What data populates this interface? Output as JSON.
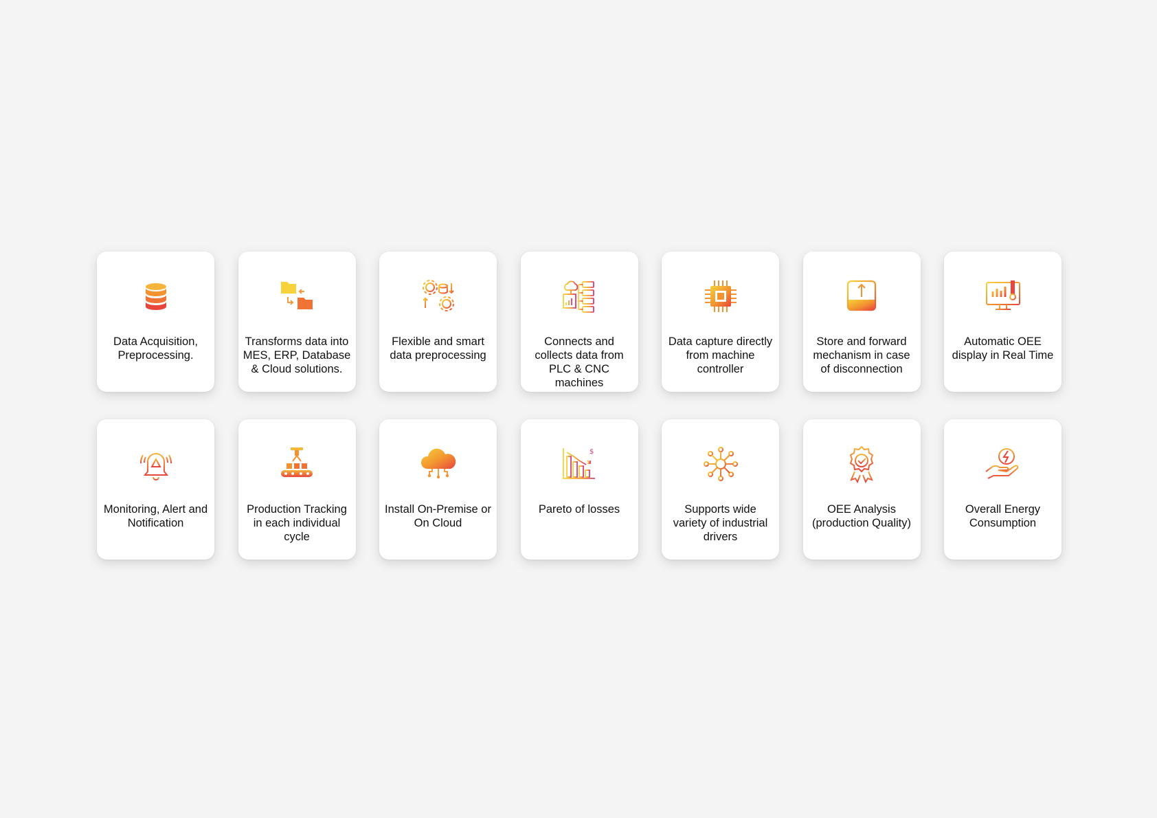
{
  "accent": {
    "gradient_start": "#f7d23a",
    "gradient_mid": "#f29330",
    "gradient_end": "#e8453c",
    "pink": "#d9367a"
  },
  "features": [
    {
      "label": "Data Acquisition,\nPreprocessing.",
      "icon": "database-icon"
    },
    {
      "label": "Transforms data into\nMES, ERP, Database\n& Cloud solutions.",
      "icon": "folder-transfer-icon"
    },
    {
      "label": "Flexible and smart\ndata preprocessing",
      "icon": "gear-data-processing-icon"
    },
    {
      "label": "Connects and\ncollects data from\nPLC & CNC\nmachines",
      "icon": "cloud-network-icon"
    },
    {
      "label": "Data capture directly\nfrom machine\ncontroller",
      "icon": "cpu-chip-icon"
    },
    {
      "label": "Store and forward\nmechanism in case\nof disconnection",
      "icon": "upload-tray-icon"
    },
    {
      "label": "Automatic OEE\ndisplay in Real Time",
      "icon": "monitor-chart-icon"
    },
    {
      "label": "Monitoring, Alert and\nNotification",
      "icon": "alert-bell-icon"
    },
    {
      "label": "Production Tracking\nin each individual\ncycle",
      "icon": "conveyor-icon"
    },
    {
      "label": "Install On-Premise or\nOn Cloud",
      "icon": "cloud-icon"
    },
    {
      "label": "Pareto of losses",
      "icon": "pareto-chart-icon"
    },
    {
      "label": "Supports wide\nvariety of industrial\ndrivers",
      "icon": "network-hub-icon"
    },
    {
      "label": "OEE Analysis\n(production Quality)",
      "icon": "quality-badge-icon"
    },
    {
      "label": "Overall Energy\nConsumption",
      "icon": "energy-hand-icon"
    }
  ]
}
